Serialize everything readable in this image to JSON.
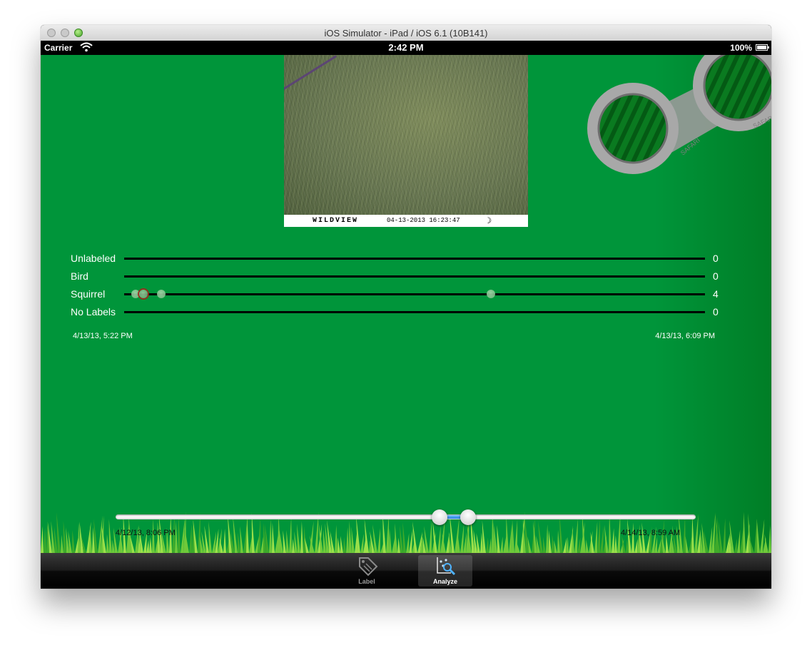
{
  "window": {
    "title": "iOS Simulator - iPad / iOS 6.1 (10B141)"
  },
  "status_bar": {
    "carrier": "Carrier",
    "time": "2:42 PM",
    "battery": "100%"
  },
  "photo": {
    "brand": "WILDVIEW",
    "timestamp": "04-13-2013  16:23:47",
    "moon_icon": "moon-icon"
  },
  "binoculars_logo": {
    "text_left": "SAFARI",
    "text_right": "SAFARI"
  },
  "colors": {
    "background": "#00953a",
    "track": "#000000",
    "dot": "#8fcf9b",
    "selected_ring": "#a0271a",
    "slider_fill": "#1f7fe0"
  },
  "tracks": [
    {
      "label": "Unlabeled",
      "count": "0",
      "events": []
    },
    {
      "label": "Bird",
      "count": "0",
      "events": []
    },
    {
      "label": "Squirrel",
      "count": "4",
      "events": [
        {
          "position": 0.02,
          "selected": false
        },
        {
          "position": 0.033,
          "selected": true
        },
        {
          "position": 0.064,
          "selected": false
        },
        {
          "position": 0.632,
          "selected": false
        }
      ]
    },
    {
      "label": "No Labels",
      "count": "0",
      "events": []
    }
  ],
  "range": {
    "start": "4/13/13, 5:22 PM",
    "end": "4/13/13, 6:09 PM"
  },
  "slider": {
    "min_label": "4/12/13, 8:06 PM",
    "max_label": "4/14/13, 8:59 AM",
    "lower_value": 0.558,
    "upper_value": 0.608
  },
  "tabbar": {
    "tabs": [
      {
        "label": "Label",
        "icon": "tag-icon",
        "active": false
      },
      {
        "label": "Analyze",
        "icon": "analyze-magnifier-icon",
        "active": true
      }
    ]
  }
}
